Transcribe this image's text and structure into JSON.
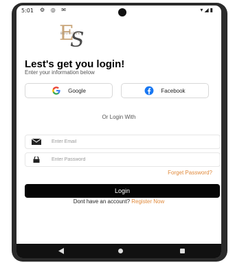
{
  "status_bar": {
    "time": "5:01",
    "icons": "⚙ ◎ ✉",
    "right_icons": "▾◢▮"
  },
  "logo": {
    "initials": "ES",
    "tagline": "Boutique"
  },
  "heading": "Lest's get you login!",
  "subheading": "Enter your information below",
  "social": {
    "google_label": "Google",
    "facebook_label": "Facebook"
  },
  "divider_text": "Or Login With",
  "email": {
    "value": "",
    "placeholder": "Enter Email"
  },
  "password": {
    "value": "",
    "placeholder": "Enter Password"
  },
  "forgot_label": "Forget Password?",
  "login_label": "Login",
  "register": {
    "prompt": "Dont have an account?",
    "link": "Register Now"
  },
  "colors": {
    "accent": "#e08a3c",
    "button": "#050505",
    "logo": "#c9a67a"
  }
}
